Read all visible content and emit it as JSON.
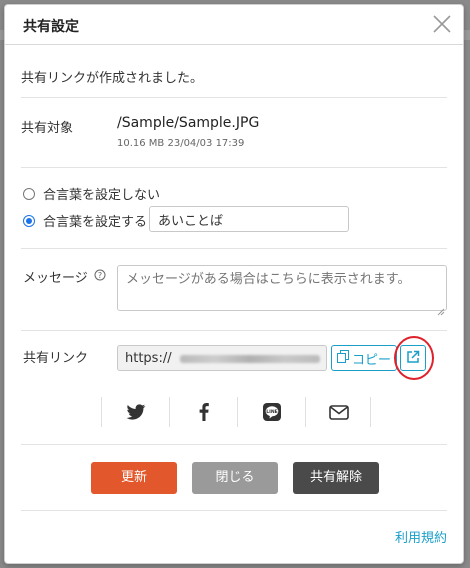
{
  "dialog": {
    "title": "共有設定",
    "close_icon": "close-icon"
  },
  "message": {
    "created": "共有リンクが作成されました。"
  },
  "target": {
    "label": "共有対象",
    "path": "/Sample/Sample.JPG",
    "meta": "10.16 MB 23/04/03 17:39"
  },
  "passphrase": {
    "option_none_label": "合言葉を設定しない",
    "option_set_label": "合言葉を設定する",
    "selected": "set",
    "value": "あいことば"
  },
  "memo": {
    "label": "メッセージ",
    "help_icon": "help-circle-icon",
    "placeholder": "メッセージがある場合はこちらに表示されます。"
  },
  "link": {
    "label": "共有リンク",
    "url_visible": "https://",
    "copy_label": "コピー",
    "copy_icon": "copy-icon",
    "open_icon": "external-link-icon",
    "highlight_color": "#e0202a"
  },
  "social": {
    "items": [
      "twitter-icon",
      "facebook-icon",
      "line-icon",
      "mail-icon"
    ]
  },
  "buttons": {
    "update": "更新",
    "close": "閉じる",
    "unshare": "共有解除"
  },
  "footer": {
    "terms": "利用規約"
  },
  "colors": {
    "update_bg": "#e2572b",
    "close_bg": "#9a9a9a",
    "unshare_bg": "#4a4a4a",
    "accent": "#1a9fc9"
  }
}
